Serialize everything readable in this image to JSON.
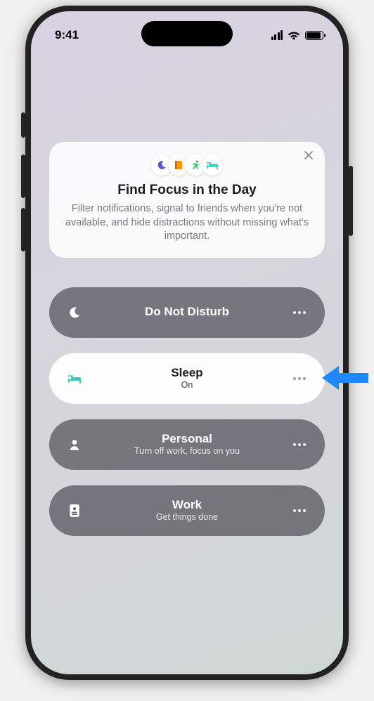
{
  "status": {
    "time": "9:41"
  },
  "card": {
    "title": "Find Focus in the Day",
    "description": "Filter notifications, signal to friends when you're not available, and hide distractions without missing what's important."
  },
  "focus": [
    {
      "icon": "moon",
      "label": "Do Not Disturb",
      "sub": "",
      "active": false
    },
    {
      "icon": "bed",
      "label": "Sleep",
      "sub": "On",
      "active": true
    },
    {
      "icon": "person",
      "label": "Personal",
      "sub": "Turn off work, focus on you",
      "active": false
    },
    {
      "icon": "badge",
      "label": "Work",
      "sub": "Get things done",
      "active": false
    }
  ]
}
